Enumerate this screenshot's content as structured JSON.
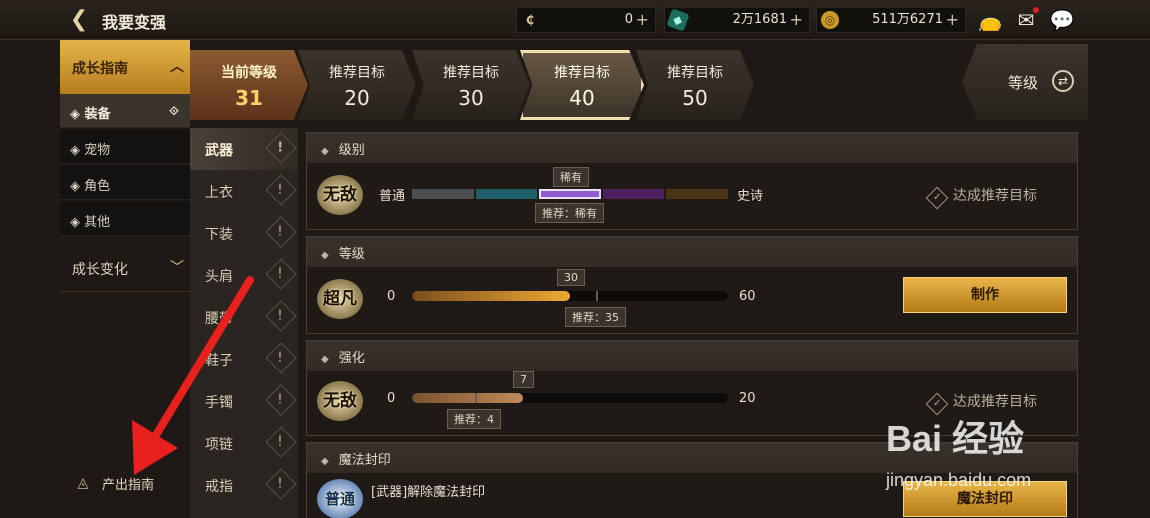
{
  "header": {
    "title": "我要变强",
    "currencies": [
      {
        "icon": "coupon-icon",
        "value": "0"
      },
      {
        "icon": "gem-icon",
        "value": "2万1681"
      },
      {
        "icon": "gold-coin-icon",
        "value": "511万6271"
      }
    ],
    "plus": "+",
    "icons": [
      "bag-icon",
      "mail-icon",
      "chat-icon"
    ]
  },
  "sidebar": {
    "group1": "成长指南",
    "items": [
      {
        "label": "装备",
        "active": true
      },
      {
        "label": "宠物"
      },
      {
        "label": "角色"
      },
      {
        "label": "其他"
      }
    ],
    "group2": "成长变化",
    "source_guide": "产出指南"
  },
  "slots": [
    "武器",
    "上衣",
    "下装",
    "头肩",
    "腰带",
    "鞋子",
    "手镯",
    "项链",
    "戒指"
  ],
  "tabs": {
    "current": {
      "label": "当前等级",
      "value": "31"
    },
    "targets": [
      {
        "label": "推荐目标",
        "value": "20"
      },
      {
        "label": "推荐目标",
        "value": "30"
      },
      {
        "label": "推荐目标",
        "value": "40",
        "selected": true
      },
      {
        "label": "推荐目标",
        "value": "50"
      }
    ],
    "sort_label": "等级"
  },
  "cards": {
    "rarity": {
      "title": "级别",
      "badge": "无敌",
      "left": "普通",
      "right": "史诗",
      "current": "稀有",
      "recommend": "推荐：稀有",
      "status": "达成推荐目标",
      "segments": [
        "#4a4e50",
        "#1f5f6a",
        "#8e5ad0",
        "#4e1f5e",
        "#4a3616"
      ],
      "selected_index": 2
    },
    "level": {
      "title": "等级",
      "badge": "超凡",
      "min": "0",
      "max": "60",
      "current": "30",
      "recommend": "推荐：35",
      "value": 30,
      "recommend_value": 35,
      "range_max": 60,
      "button": "制作"
    },
    "enhance": {
      "title": "强化",
      "badge": "无敌",
      "min": "0",
      "max": "20",
      "current": "7",
      "recommend": "推荐：4",
      "value": 7,
      "recommend_value": 4,
      "range_max": 20,
      "status": "达成推荐目标"
    },
    "seal": {
      "title": "魔法封印",
      "badge": "普通",
      "desc": "[武器]解除魔法封印",
      "button": "魔法封印"
    }
  },
  "watermark": {
    "brand": "Bai 经验",
    "url": "jingyan.baidu.com"
  }
}
